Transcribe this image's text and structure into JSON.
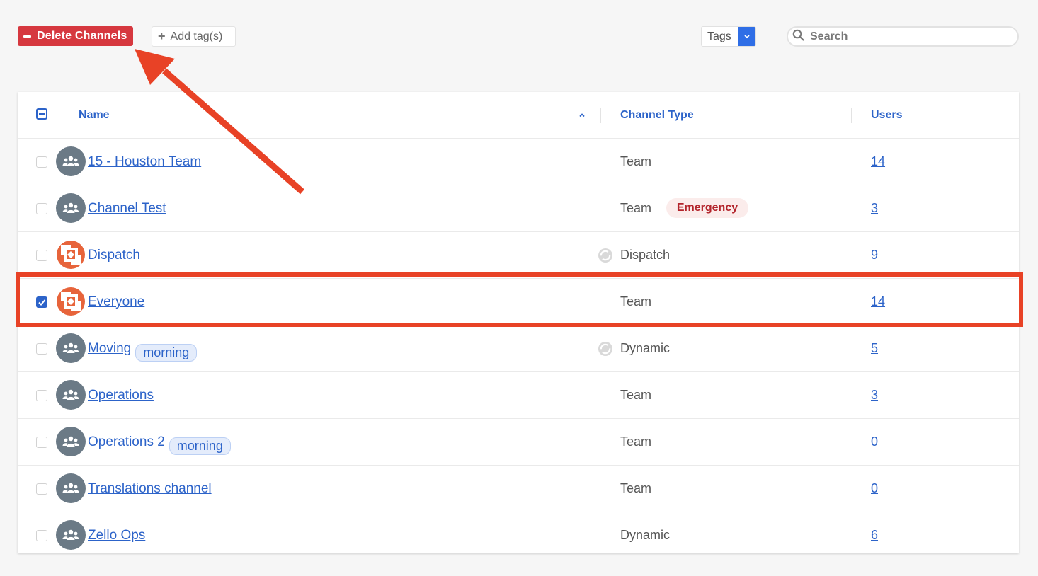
{
  "toolbar": {
    "delete_label": "Delete Channels",
    "add_tag_label": "Add tag(s)",
    "tags_label": "Tags",
    "search_placeholder": "Search"
  },
  "table": {
    "headers": {
      "name": "Name",
      "channel_type": "Channel Type",
      "users": "Users"
    },
    "sort": "ascending",
    "rows": [
      {
        "name": "15 - Houston Team",
        "avatar": "group-icon",
        "tag": "",
        "type": "Team",
        "type_badge": "",
        "type_icon": "",
        "users": "14",
        "checked": false
      },
      {
        "name": "Channel Test",
        "avatar": "group-icon",
        "tag": "",
        "type": "Team",
        "type_badge": "Emergency",
        "type_icon": "",
        "users": "3",
        "checked": false
      },
      {
        "name": "Dispatch",
        "avatar": "zello-logo",
        "tag": "",
        "type": "Dispatch",
        "type_badge": "",
        "type_icon": "sync-icon",
        "users": "9",
        "checked": false
      },
      {
        "name": "Everyone",
        "avatar": "zello-logo",
        "tag": "",
        "type": "Team",
        "type_badge": "",
        "type_icon": "",
        "users": "14",
        "checked": true
      },
      {
        "name": "Moving",
        "avatar": "group-icon",
        "tag": "morning",
        "type": "Dynamic",
        "type_badge": "",
        "type_icon": "sync-icon",
        "users": "5",
        "checked": false
      },
      {
        "name": "Operations",
        "avatar": "group-icon",
        "tag": "",
        "type": "Team",
        "type_badge": "",
        "type_icon": "",
        "users": "3",
        "checked": false
      },
      {
        "name": "Operations 2",
        "avatar": "group-icon",
        "tag": "morning",
        "type": "Team",
        "type_badge": "",
        "type_icon": "",
        "users": "0",
        "checked": false
      },
      {
        "name": "Translations channel",
        "avatar": "group-icon",
        "tag": "",
        "type": "Team",
        "type_badge": "",
        "type_icon": "",
        "users": "0",
        "checked": false
      },
      {
        "name": "Zello Ops",
        "avatar": "group-icon",
        "tag": "",
        "type": "Dynamic",
        "type_badge": "",
        "type_icon": "",
        "users": "6",
        "checked": false
      }
    ]
  },
  "colors": {
    "accent": "#2c63c9",
    "danger": "#d6383f",
    "annotation": "#e84226"
  }
}
